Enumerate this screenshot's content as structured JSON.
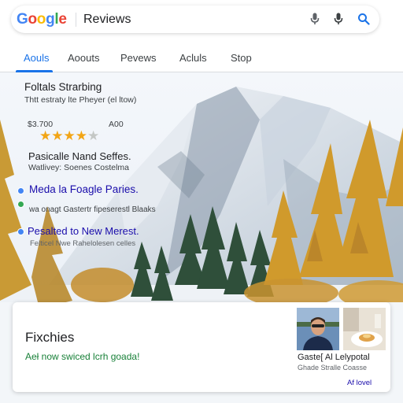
{
  "search": {
    "logo_letters": [
      "G",
      "o",
      "o",
      "g",
      "l",
      "e"
    ],
    "logo_colors": [
      "#4285f4",
      "#ea4335",
      "#fbbc05",
      "#4285f4",
      "#34a853",
      "#ea4335"
    ],
    "query": "Reviews",
    "icons": [
      "microphone-icon",
      "microphone-icon",
      "search-icon"
    ]
  },
  "tabs": [
    "Aouls",
    "Aoouts",
    "Pevews",
    "Acluls",
    "Stop"
  ],
  "active_tab": 0,
  "overlay": {
    "title": "Foltals Strarbing",
    "subtitle": "Thtt estraty lte Pheyer (el ltow)",
    "price_left": "$3.700",
    "price_right": "A00",
    "rating": 4,
    "rating_max": 5,
    "place": "Pasicalle Nand Seffes.",
    "place_sub": "Watlivey: Soenes Costelma",
    "media_link": "Meda la Foagle Paries.",
    "media_sub": "wa onagt Gastertr fipeserestl Blaaks",
    "link": "Pesalted to New Merest.",
    "link_sub": "Felticel Nwe Rahelolesen celles"
  },
  "card": {
    "title": "Fixchies",
    "subtitle": "Aeł now swiced lcrh goada!",
    "name": "Gaste[ Al Lelypotal",
    "meta": "Ghade Stralle Coasse",
    "link": "Af lovel"
  },
  "colors": {
    "accent": "#1a73e8",
    "link": "#1a0dab",
    "star": "#f2a516",
    "green": "#188038"
  }
}
